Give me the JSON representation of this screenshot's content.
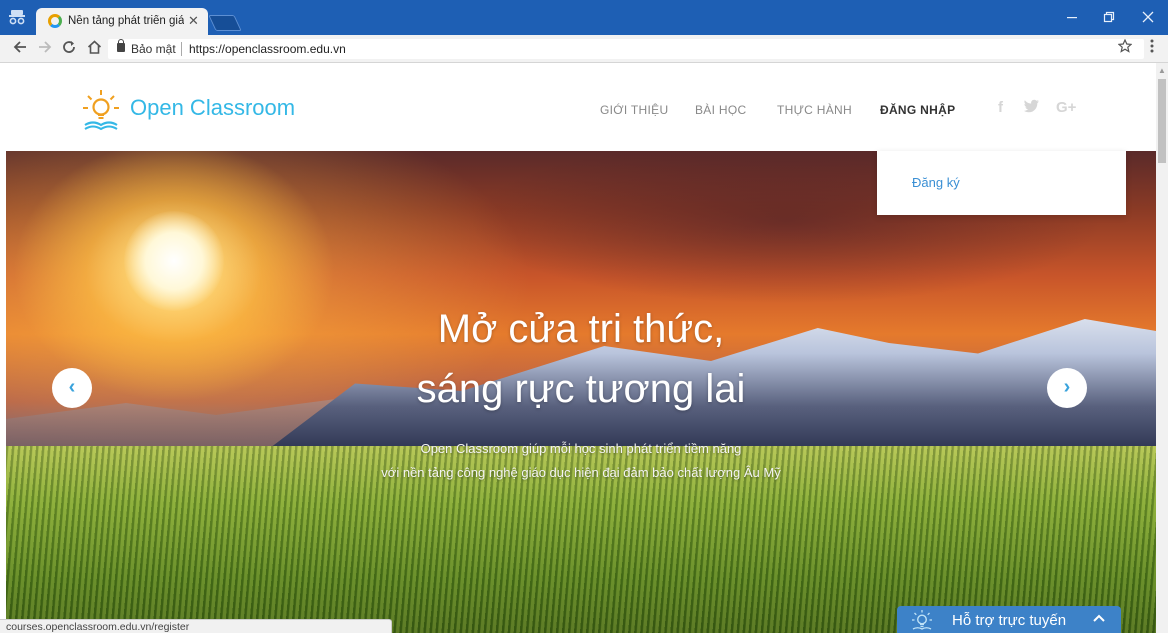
{
  "browser": {
    "tab_title": "Nền tảng phát triển giáo",
    "tab_close": "✕",
    "secure_label": "Bảo mật",
    "url": "https://openclassroom.edu.vn",
    "status_url": "courses.openclassroom.edu.vn/register",
    "icons": [
      "incognito-icon",
      "back-icon",
      "forward-icon",
      "reload-icon",
      "home-icon",
      "lock-icon",
      "star-icon",
      "menu-icon",
      "minimize-icon",
      "maximize-icon",
      "close-icon"
    ]
  },
  "site": {
    "logo_text": "Open Classroom",
    "nav": {
      "gioi_thieu": "GIỚI THIỆU",
      "bai_hoc": "BÀI HỌC",
      "thuc_hanh": "THỰC HÀNH",
      "dang_nhap": "ĐĂNG NHẬP"
    },
    "social": {
      "facebook": "f",
      "twitter": "🐦",
      "googleplus": "G+"
    },
    "dropdown": {
      "dang_ky": "Đăng ký"
    },
    "hero": {
      "title_line1": "Mở cửa tri thức,",
      "title_line2": "sáng rực tương lai",
      "sub_line1": "Open Classroom giúp mỗi học sinh phát triển tiềm năng",
      "sub_line2": "với nền tảng công nghệ giáo dục hiện đại đảm bảo chất lượng Âu Mỹ",
      "prev_arrow": "‹",
      "next_arrow": "›"
    },
    "support": {
      "label": "Hỗ trợ trực tuyến",
      "chevron": "⌃"
    }
  },
  "colors": {
    "titlebar": "#1e5fb4",
    "logo": "#34b8e6",
    "link": "#3a8fd4",
    "support": "#3d82c8"
  }
}
